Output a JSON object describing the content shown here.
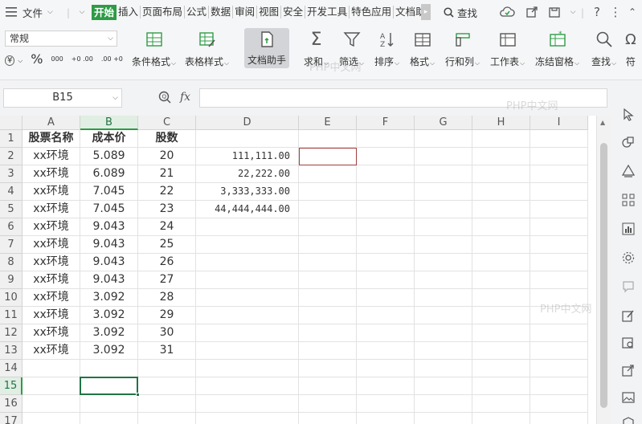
{
  "menubar": {
    "file_label": "文件",
    "tabs": [
      "开始",
      "插入",
      "页面布局",
      "公式",
      "数据",
      "审阅",
      "视图",
      "安全",
      "开发工具",
      "特色应用",
      "文档助"
    ],
    "search_label": "查找"
  },
  "toolbar": {
    "number_format": "常规",
    "small_buttons": [
      "¥",
      "%",
      "000",
      "+0 .00",
      ".00 +0"
    ],
    "tools": [
      "条件格式",
      "表格样式",
      "文档助手",
      "求和",
      "筛选",
      "排序",
      "格式",
      "行和列",
      "工作表",
      "冻结窗格",
      "查找",
      "符"
    ]
  },
  "formula_bar": {
    "cell_ref": "B15",
    "fx_label": "fx",
    "content": ""
  },
  "sheet": {
    "columns": [
      "A",
      "B",
      "C",
      "D",
      "E",
      "F",
      "G",
      "H",
      "I"
    ],
    "selected_column": "B",
    "rows": [
      "1",
      "2",
      "3",
      "4",
      "5",
      "6",
      "7",
      "8",
      "9",
      "10",
      "11",
      "12",
      "13",
      "14",
      "15",
      "16",
      "17"
    ],
    "selected_row": "15",
    "headers": [
      "股票名称",
      "成本价",
      "股数"
    ],
    "data": [
      [
        "xx环境",
        "5.089",
        "20",
        "111,111.00"
      ],
      [
        "xx环境",
        "6.089",
        "21",
        "22,222.00"
      ],
      [
        "xx环境",
        "7.045",
        "22",
        "3,333,333.00"
      ],
      [
        "xx环境",
        "7.045",
        "23",
        "44,444,444.00"
      ],
      [
        "xx环境",
        "9.043",
        "24",
        ""
      ],
      [
        "xx环境",
        "9.043",
        "25",
        ""
      ],
      [
        "xx环境",
        "9.043",
        "26",
        ""
      ],
      [
        "xx环境",
        "9.043",
        "27",
        ""
      ],
      [
        "xx环境",
        "3.092",
        "28",
        ""
      ],
      [
        "xx环境",
        "3.092",
        "29",
        ""
      ],
      [
        "xx环境",
        "3.092",
        "30",
        ""
      ],
      [
        "xx环境",
        "3.092",
        "31",
        ""
      ]
    ]
  },
  "watermark": "PHP中文网",
  "colors": {
    "accent": "#2e9b46",
    "selection": "#217346"
  }
}
